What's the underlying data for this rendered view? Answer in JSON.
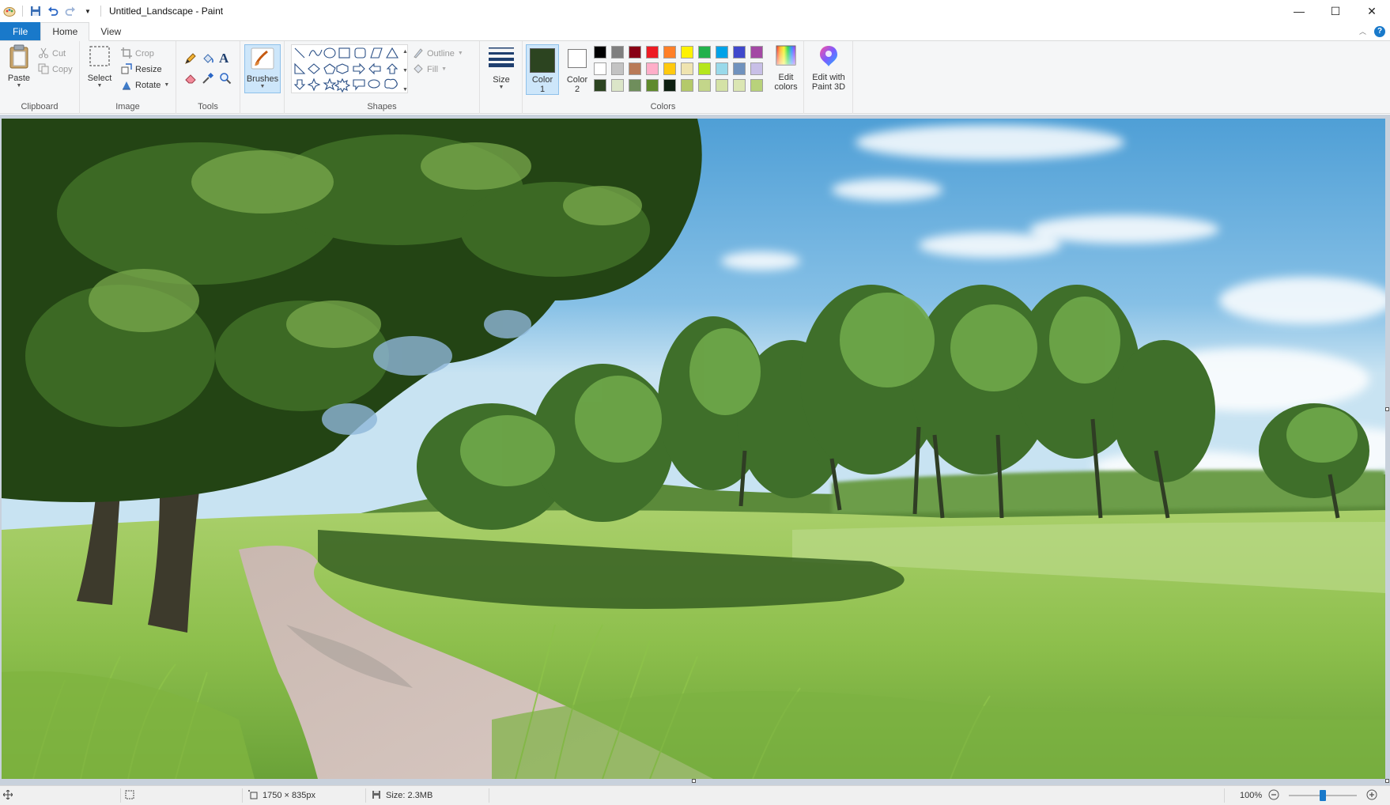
{
  "window": {
    "title": "Untitled_Landscape - Paint",
    "minimize": "—",
    "maximize": "☐",
    "close": "✕"
  },
  "tabs": [
    {
      "label": "File"
    },
    {
      "label": "Home"
    },
    {
      "label": "View"
    }
  ],
  "ribbon": {
    "clipboard": {
      "label": "Clipboard",
      "paste": "Paste",
      "cut": "Cut",
      "copy": "Copy"
    },
    "image": {
      "label": "Image",
      "select": "Select",
      "crop": "Crop",
      "resize": "Resize",
      "rotate": "Rotate"
    },
    "tools": {
      "label": "Tools"
    },
    "brushes": {
      "label": "Brushes"
    },
    "shapes": {
      "label": "Shapes",
      "outline": "Outline",
      "fill": "Fill"
    },
    "size": {
      "label": "Size"
    },
    "colors": {
      "label": "Colors",
      "color1_label_a": "Color",
      "color1_label_b": "1",
      "color2_label_a": "Color",
      "color2_label_b": "2",
      "color1": "#2c4420",
      "color2": "#ffffff",
      "edit_colors_a": "Edit",
      "edit_colors_b": "colors",
      "palette_row1": [
        "#000000",
        "#7f7f7f",
        "#880015",
        "#ed1c24",
        "#ff7f27",
        "#fff200",
        "#22b14c",
        "#00a2e8",
        "#3f48cc",
        "#a349a4"
      ],
      "palette_row2": [
        "#ffffff",
        "#c3c3c3",
        "#b97a57",
        "#ffaec9",
        "#ffc90e",
        "#efe4b0",
        "#b5e61d",
        "#99d9ea",
        "#7092be",
        "#c8bfe7"
      ],
      "palette_row3": [
        "#2c4420",
        "#dbe5c8",
        "#6f8e5c",
        "#5f8a2c",
        "#0d1f10",
        "#b4c96a",
        "#c3d68a",
        "#d4e2a6",
        "#dbe6b3",
        "#b8d27b"
      ]
    },
    "paint3d": {
      "label_a": "Edit with",
      "label_b": "Paint 3D"
    }
  },
  "statusbar": {
    "dimensions": "1750 × 835px",
    "size": "Size: 2.3MB",
    "zoom": "100%",
    "zoom_fraction": 0.5
  }
}
